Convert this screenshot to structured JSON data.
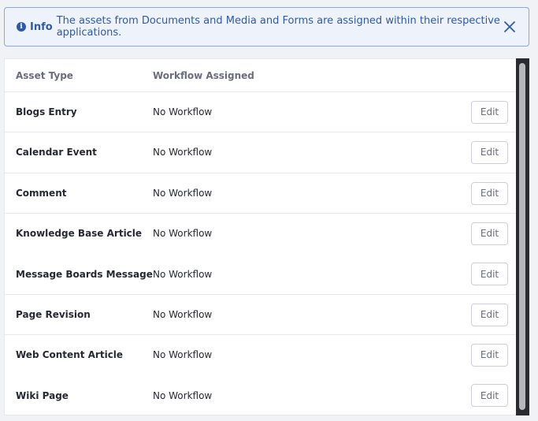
{
  "alert": {
    "lead": "Info",
    "message": "The assets from Documents and Media and Forms are assigned within their respective applications."
  },
  "table": {
    "headers": {
      "asset_type": "Asset Type",
      "workflow": "Workflow Assigned"
    },
    "rows": [
      {
        "asset_type": "Blogs Entry",
        "workflow": "No Workflow",
        "action": "Edit"
      },
      {
        "asset_type": "Calendar Event",
        "workflow": "No Workflow",
        "action": "Edit"
      },
      {
        "asset_type": "Comment",
        "workflow": "No Workflow",
        "action": "Edit"
      },
      {
        "asset_type": "Knowledge Base Article",
        "workflow": "No Workflow",
        "action": "Edit"
      },
      {
        "asset_type": "Message Boards Message",
        "workflow": "No Workflow",
        "action": "Edit"
      },
      {
        "asset_type": "Page Revision",
        "workflow": "No Workflow",
        "action": "Edit"
      },
      {
        "asset_type": "Web Content Article",
        "workflow": "No Workflow",
        "action": "Edit"
      },
      {
        "asset_type": "Wiki Page",
        "workflow": "No Workflow",
        "action": "Edit"
      }
    ]
  },
  "icons": {
    "alert": "info-icon",
    "dismiss": "close-icon"
  },
  "colors": {
    "info_text": "#2e5aac",
    "info_bg": "#eef2fa",
    "info_border": "#89a7e0"
  }
}
